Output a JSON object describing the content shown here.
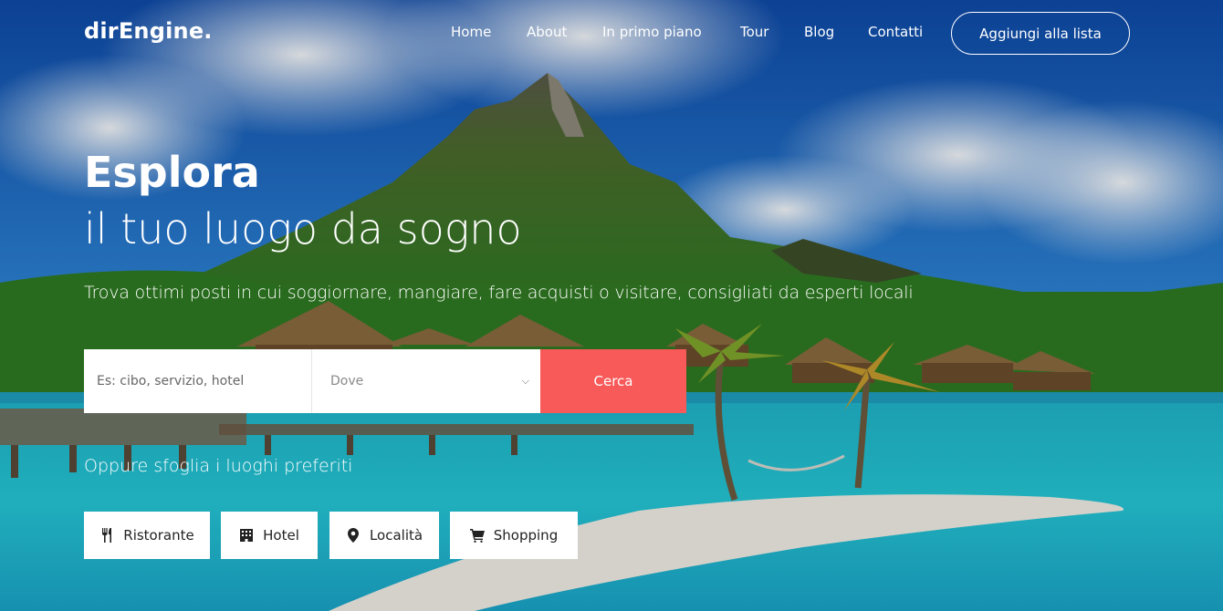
{
  "nav": {
    "brand": "dirEngine.",
    "links": [
      "Home",
      "About",
      "In primo piano",
      "Tour",
      "Blog",
      "Contatti"
    ],
    "cta": "Aggiungi alla lista"
  },
  "hero": {
    "title": "Esplora",
    "subtitle": "il tuo luogo da sogno",
    "description": "Trova ottimi posti in cui soggiornare, mangiare, fare acquisti o visitare, consigliati da esperti locali"
  },
  "search": {
    "query_placeholder": "Es: cibo, servizio, hotel",
    "location_selected": "Dove",
    "button": "Cerca"
  },
  "browse": {
    "label": "Oppure sfoglia i luoghi preferiti",
    "categories": [
      {
        "label": "Ristorante",
        "icon": "cutlery-icon"
      },
      {
        "label": "Hotel",
        "icon": "building-icon"
      },
      {
        "label": "Località",
        "icon": "map-pin-icon"
      },
      {
        "label": "Shopping",
        "icon": "cart-icon"
      }
    ]
  },
  "colors": {
    "accent": "#f85959",
    "sky": "#1d6fc4",
    "lagoon": "#2bc6d6"
  }
}
